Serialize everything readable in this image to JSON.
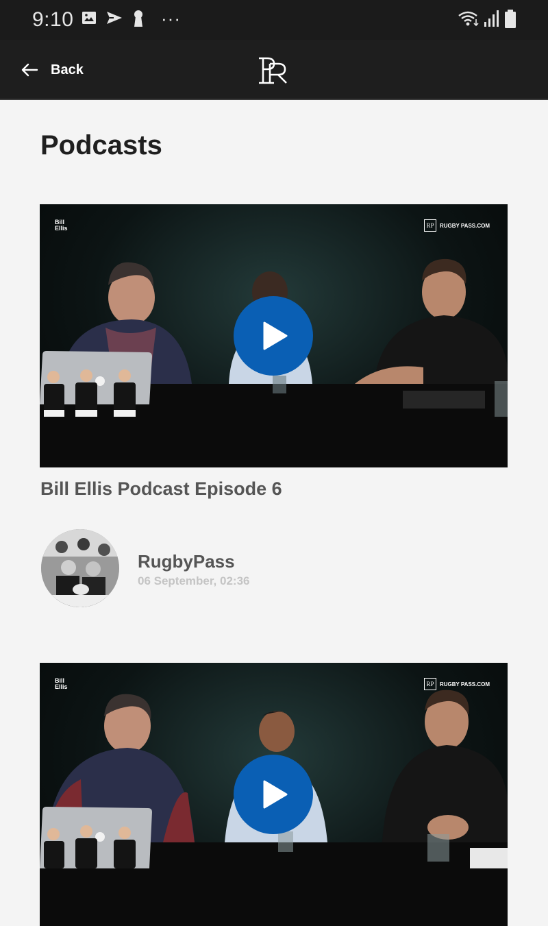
{
  "status_bar": {
    "time": "9:10",
    "more_indicator": "···",
    "left_icons": [
      "image-icon",
      "send-icon",
      "keyhole-icon"
    ],
    "right_icons": [
      "wifi-icon",
      "signal-icon",
      "battery-icon"
    ]
  },
  "header": {
    "back_label": "Back",
    "logo_text": "RP",
    "background": "#1e1e1e"
  },
  "page": {
    "title": "Podcasts"
  },
  "cards": [
    {
      "title": "Bill Ellis Podcast Episode 6",
      "author": "RugbyPass",
      "date": "06 September, 02:36",
      "brand_left": "Bill Ellis",
      "brand_right": "RUGBY PASS.COM",
      "play_icon": "play-icon"
    },
    {
      "title": "",
      "brand_left": "Bill Ellis",
      "brand_right": "RUGBY PASS.COM",
      "play_icon": "play-icon"
    }
  ],
  "colors": {
    "status_bar": "#1b1b1b",
    "page_background": "#f4f4f4",
    "play_button": "#0a5fb4",
    "title_text": "#1f1f1f",
    "card_title_text": "#555555",
    "date_text": "#c4c4c4"
  }
}
